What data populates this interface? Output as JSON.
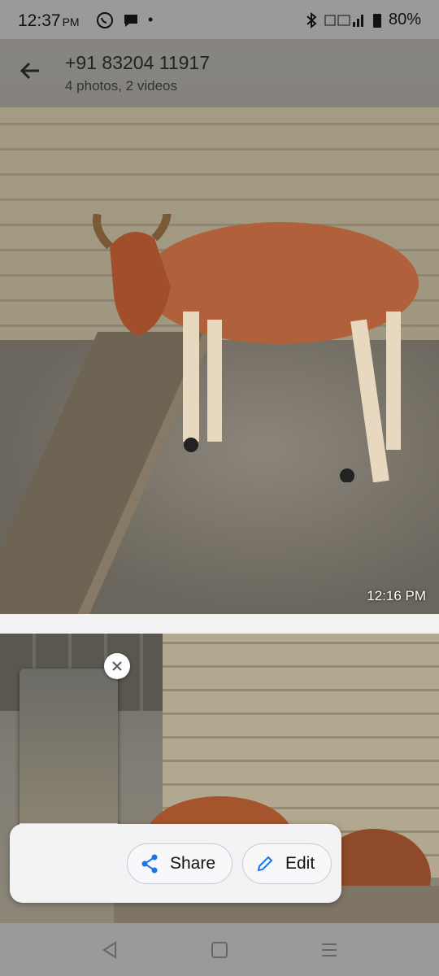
{
  "status_bar": {
    "time": "12:37",
    "ampm": "PM",
    "dot": "•",
    "battery": "80%"
  },
  "toolbar": {
    "title": "+91 83204 11917",
    "subtitle": "4 photos, 2 videos"
  },
  "photo1": {
    "timestamp": "12:16 PM"
  },
  "actions": {
    "share_label": "Share",
    "edit_label": "Edit"
  },
  "colors": {
    "accent": "#1a73e8",
    "cow": "#b0603a"
  }
}
